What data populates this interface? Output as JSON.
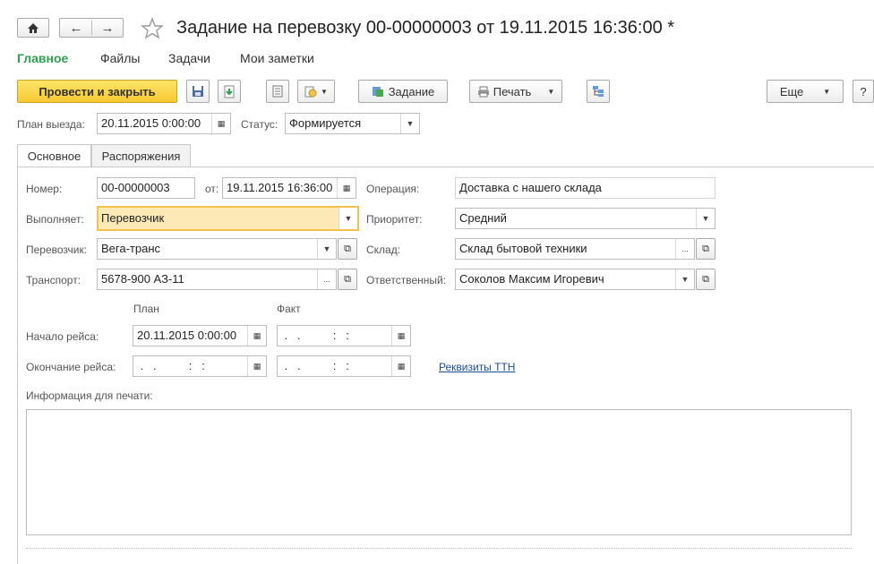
{
  "header": {
    "title": "Задание на перевозку 00-00000003 от 19.11.2015 16:36:00 *"
  },
  "menu": {
    "items": [
      "Главное",
      "Файлы",
      "Задачи",
      "Мои заметки"
    ]
  },
  "toolbar": {
    "post_close": "Провести и закрыть",
    "task": "Задание",
    "print": "Печать",
    "more": "Еще",
    "help": "?"
  },
  "topfields": {
    "plan_label": "План выезда:",
    "plan_value": "20.11.2015  0:00:00",
    "status_label": "Статус:",
    "status_value": "Формируется"
  },
  "tabs": [
    "Основное",
    "Распоряжения"
  ],
  "form": {
    "number_label": "Номер:",
    "number_value": "00-00000003",
    "from_label": "от:",
    "from_value": "19.11.2015 16:36:00",
    "operation_label": "Операция:",
    "operation_value": "Доставка с нашего склада",
    "performer_label": "Выполняет:",
    "performer_value": "Перевозчик",
    "priority_label": "Приоритет:",
    "priority_value": "Средний",
    "carrier_label": "Перевозчик:",
    "carrier_value": "Вега-транс",
    "warehouse_label": "Склад:",
    "warehouse_value": "Склад бытовой техники",
    "transport_label": "Транспорт:",
    "transport_value": "5678-900 АЗ-11",
    "responsible_label": "Ответственный:",
    "responsible_value": "Соколов Максим Игоревич",
    "plan_col": "План",
    "fact_col": "Факт",
    "trip_start_label": "Начало рейса:",
    "trip_start_plan": "20.11.2015  0:00:00",
    "trip_start_fact": " .   .          :   :",
    "trip_end_label": "Окончание рейса:",
    "trip_end_plan": " .   .          :   :",
    "trip_end_fact": " .   .          :   :",
    "ttn_link": "Реквизиты ТТН",
    "print_info_label": "Информация для печати:"
  }
}
